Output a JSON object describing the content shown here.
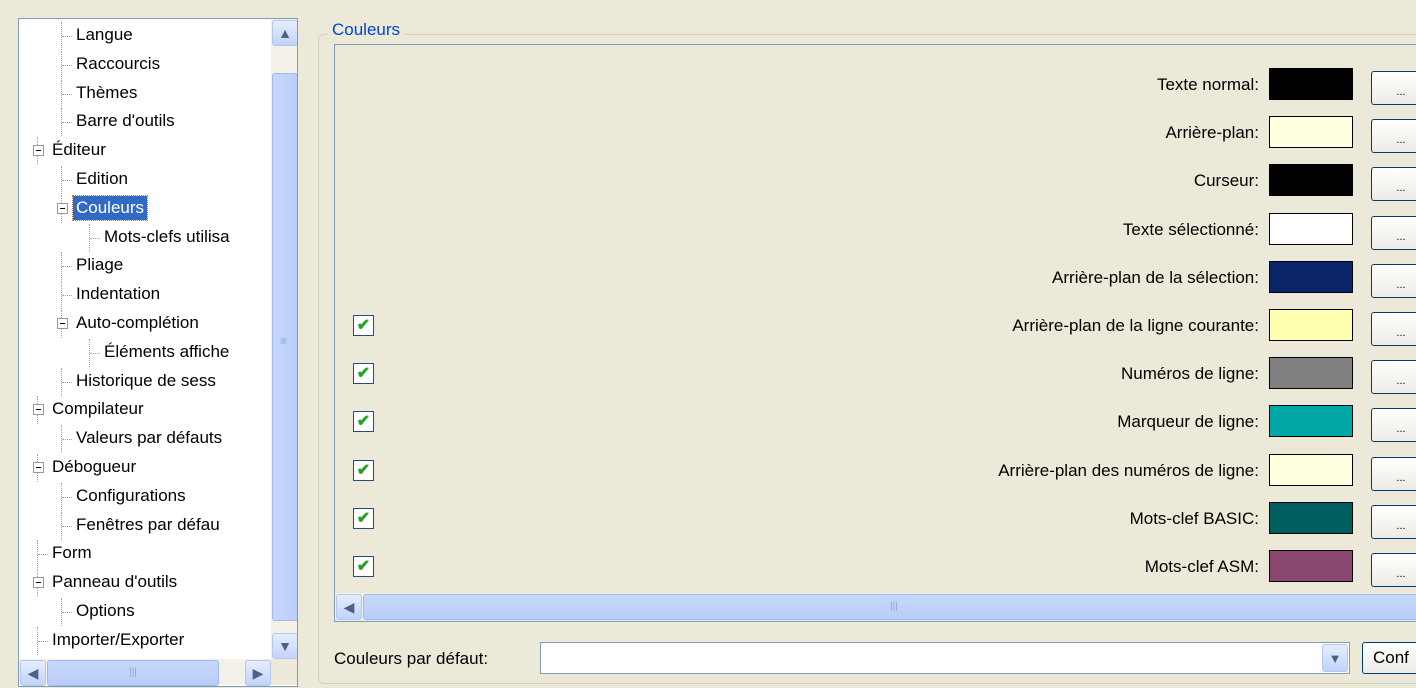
{
  "tree": {
    "items": [
      {
        "label": "Langue",
        "level": 2
      },
      {
        "label": "Raccourcis",
        "level": 2
      },
      {
        "label": "Thèmes",
        "level": 2
      },
      {
        "label": "Barre d'outils",
        "level": 2
      },
      {
        "label": "Éditeur",
        "level": 1,
        "expanded": true
      },
      {
        "label": "Edition",
        "level": 2
      },
      {
        "label": "Couleurs",
        "level": 2,
        "expanded": true,
        "selected": true
      },
      {
        "label": "Mots-clefs utilisa",
        "level": 3
      },
      {
        "label": "Pliage",
        "level": 2
      },
      {
        "label": "Indentation",
        "level": 2
      },
      {
        "label": "Auto-complétion",
        "level": 2,
        "expanded": true
      },
      {
        "label": "Éléments affiche",
        "level": 3
      },
      {
        "label": "Historique de sess",
        "level": 2
      },
      {
        "label": "Compilateur",
        "level": 1,
        "expanded": true
      },
      {
        "label": "Valeurs par défauts",
        "level": 2
      },
      {
        "label": "Débogueur",
        "level": 1,
        "expanded": true
      },
      {
        "label": "Configurations",
        "level": 2
      },
      {
        "label": "Fenêtres par défau",
        "level": 2
      },
      {
        "label": "Form",
        "level": 1
      },
      {
        "label": "Panneau d'outils",
        "level": 1,
        "expanded": true
      },
      {
        "label": "Options",
        "level": 2
      },
      {
        "label": "Importer/Exporter",
        "level": 1
      }
    ],
    "scroll_up_icon": "chevron-up-icon",
    "scroll_down_icon": "chevron-down-icon",
    "scroll_left_icon": "chevron-left-icon",
    "scroll_right_icon": "chevron-right-icon",
    "grip_glyph": "|||",
    "grip_v_glyph": "≡"
  },
  "group": {
    "title": "Couleurs"
  },
  "colors": [
    {
      "label": "Texte normal:",
      "swatch": "#000000",
      "checkbox": false,
      "button": "..."
    },
    {
      "label": "Arrière-plan:",
      "swatch": "#ffffe0",
      "checkbox": false,
      "button": "..."
    },
    {
      "label": "Curseur:",
      "swatch": "#000000",
      "checkbox": false,
      "button": "..."
    },
    {
      "label": "Texte sélectionné:",
      "swatch": "#ffffff",
      "checkbox": false,
      "button": "..."
    },
    {
      "label": "Arrière-plan de la sélection:",
      "swatch": "#0a246a",
      "checkbox": false,
      "button": "..."
    },
    {
      "label": "Arrière-plan de la ligne courante:",
      "swatch": "#ffffb0",
      "checkbox": true,
      "checked": true,
      "button": "..."
    },
    {
      "label": "Numéros de ligne:",
      "swatch": "#808080",
      "checkbox": true,
      "checked": true,
      "button": "..."
    },
    {
      "label": "Marqueur de ligne:",
      "swatch": "#00a8a8",
      "checkbox": true,
      "checked": true,
      "button": "..."
    },
    {
      "label": "Arrière-plan des numéros de ligne:",
      "swatch": "#ffffe0",
      "checkbox": true,
      "checked": true,
      "button": "..."
    },
    {
      "label": "Mots-clef BASIC:",
      "swatch": "#006060",
      "checkbox": true,
      "checked": true,
      "button": "..."
    },
    {
      "label": "Mots-clef ASM:",
      "swatch": "#8a4870",
      "checkbox": true,
      "checked": true,
      "button": "..."
    },
    {
      "label": "",
      "swatch": "#00005a",
      "checkbox": true,
      "checked": true,
      "button": "..."
    }
  ],
  "defaults": {
    "label": "Couleurs par défaut:",
    "value": "",
    "dropdown_icon": "chevron-down-icon",
    "confirm_label": "Conf"
  }
}
